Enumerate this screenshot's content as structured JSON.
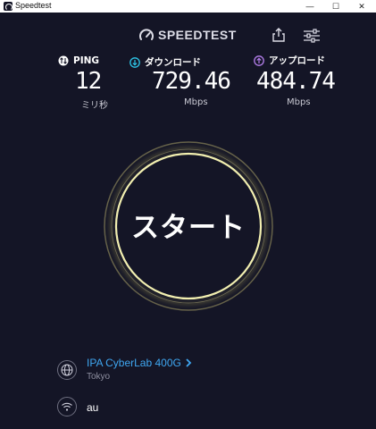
{
  "window": {
    "title": "Speedtest",
    "minimize_glyph": "—",
    "maximize_glyph": "☐",
    "close_glyph": "✕"
  },
  "header": {
    "brand": "SPEEDTEST",
    "share_icon": "share-icon",
    "settings_icon": "settings-sliders-icon"
  },
  "metrics": {
    "ping": {
      "label": "PING",
      "value": "12",
      "unit": "ミリ秒",
      "icon": "ping-icon"
    },
    "download": {
      "label": "ダウンロード",
      "value": "729.46",
      "unit": "Mbps",
      "icon": "download-arrow-icon",
      "color": "#2ec6e8"
    },
    "upload": {
      "label": "アップロード",
      "value": "484.74",
      "unit": "Mbps",
      "icon": "upload-arrow-icon",
      "color": "#b37eea"
    }
  },
  "start": {
    "label": "スタート",
    "ring_color": "#f2efb0"
  },
  "server": {
    "name": "IPA CyberLab 400G",
    "city": "Tokyo",
    "icon": "globe-icon"
  },
  "isp": {
    "name": "au",
    "icon": "wifi-icon"
  },
  "colors": {
    "background": "#141526",
    "accent_blue": "#3fa7f2"
  }
}
